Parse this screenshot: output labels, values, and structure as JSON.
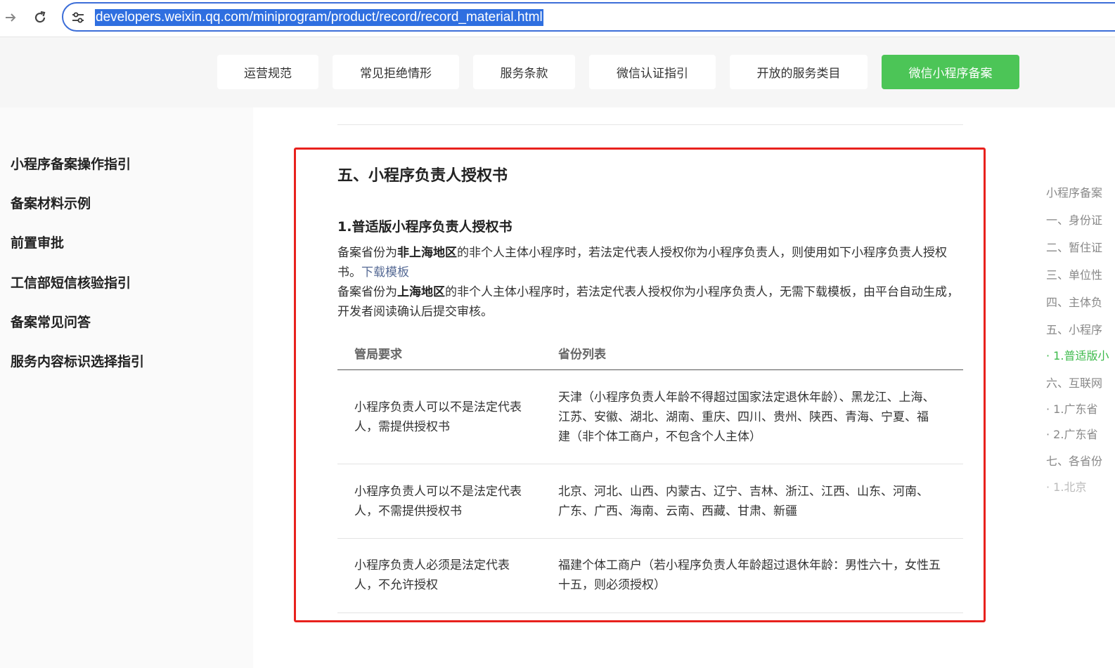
{
  "browser": {
    "url": "developers.weixin.qq.com/miniprogram/product/record/record_material.html",
    "back_icon": "arrow-right-icon",
    "reload_icon": "reload-icon",
    "site_info_icon": "tune-icon"
  },
  "top_nav": {
    "items": [
      "运营规范",
      "常见拒绝情形",
      "服务条款",
      "微信认证指引",
      "开放的服务类目",
      "微信小程序备案"
    ],
    "active_color": "#4cc557"
  },
  "left_sidebar": {
    "items": [
      "小程序备案操作指引",
      "备案材料示例",
      "前置审批",
      "工信部短信核验指引",
      "备案常见问答",
      "服务内容标识选择指引"
    ]
  },
  "content": {
    "section_title": "五、小程序负责人授权书",
    "sub_title": "1.普适版小程序负责人授权书",
    "para1": {
      "pre": "备案省份为",
      "bold": "非上海地区",
      "post": "的非个人主体小程序时，若法定代表人授权你为小程序负责人，则使用如下小程序负责人授权书。",
      "link": "下载模板"
    },
    "para2": {
      "pre": "备案省份为",
      "bold": "上海地区",
      "post": "的非个人主体小程序时，若法定代表人授权你为小程序负责人，无需下载模板，由平台自动生成，开发者阅读确认后提交审核。"
    },
    "table": {
      "headers": [
        "管局要求",
        "省份列表"
      ],
      "rows": [
        [
          "小程序负责人可以不是法定代表人，需提供授权书",
          "天津（小程序负责人年龄不得超过国家法定退休年龄）、黑龙江、上海、江苏、安徽、湖北、湖南、重庆、四川、贵州、陕西、青海、宁夏、福建（非个体工商户，不包含个人主体）"
        ],
        [
          "小程序负责人可以不是法定代表人，不需提供授权书",
          "北京、河北、山西、内蒙古、辽宁、吉林、浙江、江西、山东、河南、广东、广西、海南、云南、西藏、甘肃、新疆"
        ],
        [
          "小程序负责人必须是法定代表人，不允许授权",
          "福建个体工商户（若小程序负责人年龄超过退休年龄：男性六十，女性五十五，则必须授权）"
        ]
      ]
    }
  },
  "right_toc": {
    "items": [
      "小程序备案",
      "一、身份证",
      "二、暂住证",
      "三、单位性",
      "四、主体负",
      "五、小程序",
      "· 1.普适版小",
      "六、互联网",
      "· 1.广东省",
      "· 2.广东省",
      "七、各省份",
      "· 1.北京"
    ],
    "active_index": 6,
    "active_color": "#3cba4b"
  },
  "highlight_color": "#e8211d"
}
